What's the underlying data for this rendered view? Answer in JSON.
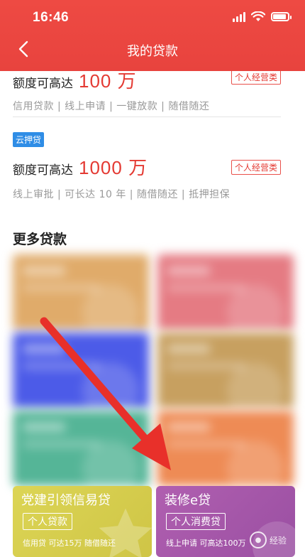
{
  "status": {
    "time": "16:46"
  },
  "nav": {
    "title": "我的贷款"
  },
  "loans": [
    {
      "label": "额度可高达",
      "amount": "100 万",
      "tag": "个人经营类",
      "desc": "信用贷款 | 线上申请 | 一键放款 | 随借随还"
    },
    {
      "badge": "云押贷",
      "label": "额度可高达",
      "amount": "1000 万",
      "tag": "个人经营类",
      "desc": "线上审批 | 可长达 10 年 | 随借随还 | 抵押担保"
    }
  ],
  "more": {
    "title": "更多贷款"
  },
  "bottom_cards": [
    {
      "title": "党建引领信易贷",
      "tag": "个人贷款",
      "desc": "信用贷  可达15万  随借随还",
      "color": "#d9d24f"
    },
    {
      "title": "装修e贷",
      "tag": "个人消费贷",
      "desc": "线上申请  可高达100万",
      "color": "#a457a8"
    }
  ],
  "watermark": {
    "text": "经验"
  },
  "colors": {
    "header": "#ee4a43",
    "accent": "#e43a33",
    "arrow": "#e8302a",
    "tiles": [
      "#e0ab6a",
      "#e57b83",
      "#4c5be8",
      "#c7a060",
      "#55b597",
      "#ee8b55"
    ]
  }
}
